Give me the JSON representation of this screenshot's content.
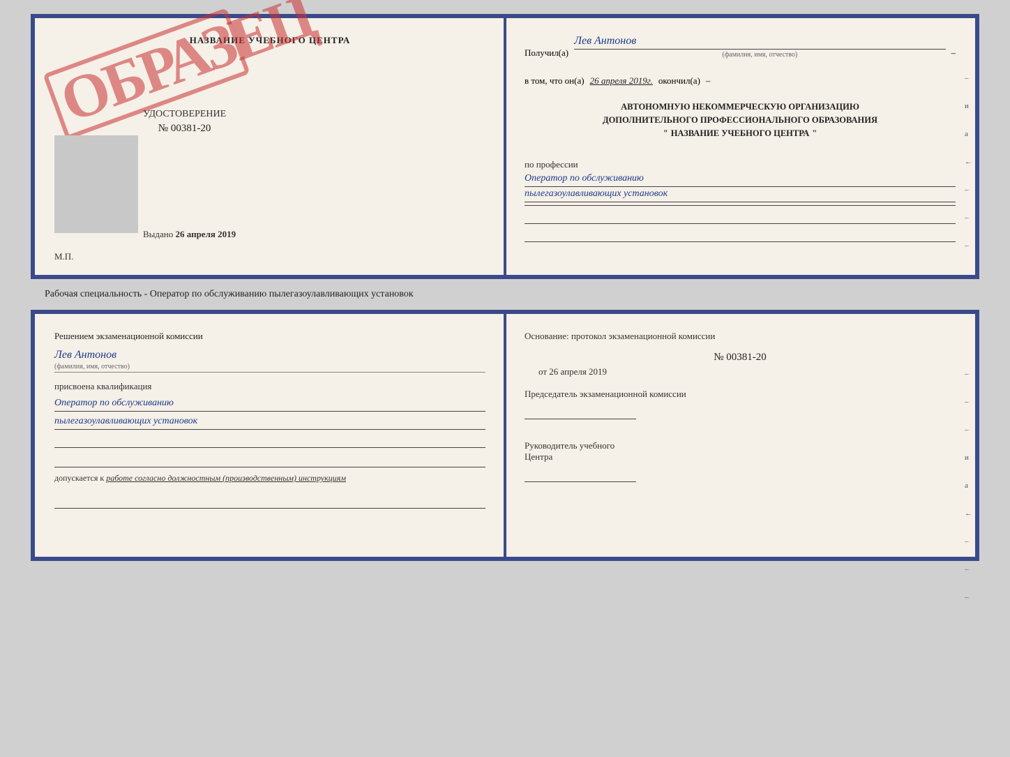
{
  "cert": {
    "left": {
      "title": "НАЗВАНИЕ УЧЕБНОГО ЦЕНТРА",
      "udostoverenie_label": "УДОСТОВЕРЕНИЕ",
      "number": "№ 00381-20",
      "sample_stamp": "ОБРАЗЕЦ",
      "issued_label": "Выдано",
      "issued_date": "26 апреля 2019",
      "mp_label": "М.П."
    },
    "right": {
      "received_label": "Получил(а)",
      "recipient_name": "Лев Антонов",
      "fio_label": "(фамилия, имя, отчество)",
      "dash1": "–",
      "in_that_label": "в том, что он(а)",
      "completed_date": "26 апреля 2019г.",
      "completed_label": "окончил(а)",
      "dash2": "–",
      "org_line1": "АВТОНОМНУЮ НЕКОММЕРЧЕСКУЮ ОРГАНИЗАЦИЮ",
      "org_line2": "ДОПОЛНИТЕЛЬНОГО ПРОФЕССИОНАЛЬНОГО ОБРАЗОВАНИЯ",
      "org_quotes": "\"",
      "org_name": "НАЗВАНИЕ УЧЕБНОГО ЦЕНТРА",
      "org_quotes2": "\"",
      "dash3": "–",
      "by_profession_label": "по профессии",
      "profession_line1": "Оператор по обслуживанию",
      "profession_line2": "пылегазоулавливающих установок",
      "sidebar_marks": [
        "–",
        "и",
        "а",
        "←",
        "–",
        "–",
        "–"
      ]
    }
  },
  "specialty_text": "Рабочая специальность - Оператор по обслуживанию пылегазоулавливающих установок",
  "qual": {
    "left": {
      "commission_text": "Решением экзаменационной комиссии",
      "name": "Лев Антонов",
      "fio_label": "(фамилия, имя, отчество)",
      "assigned_label": "присвоена квалификация",
      "profession_line1": "Оператор по обслуживанию",
      "profession_line2": "пылегазоулавливающих установок",
      "допускается_label": "допускается к",
      "допускается_value": "работе согласно должностным (производственным) инструкциям"
    },
    "right": {
      "osnov_label": "Основание: протокол экзаменационной комиссии",
      "protocol_num": "№ 00381-20",
      "date_prefix": "от",
      "date_value": "26 апреля 2019",
      "dash1": "–",
      "chairman_label": "Председатель экзаменационной комиссии",
      "dash2": "–",
      "dash3": "–",
      "rukov_label": "Руководитель учебного",
      "tsentra_label": "Центра",
      "sidebar_marks": [
        "–",
        "–",
        "–",
        "и",
        "а",
        "←",
        "–",
        "–",
        "–"
      ]
    }
  }
}
